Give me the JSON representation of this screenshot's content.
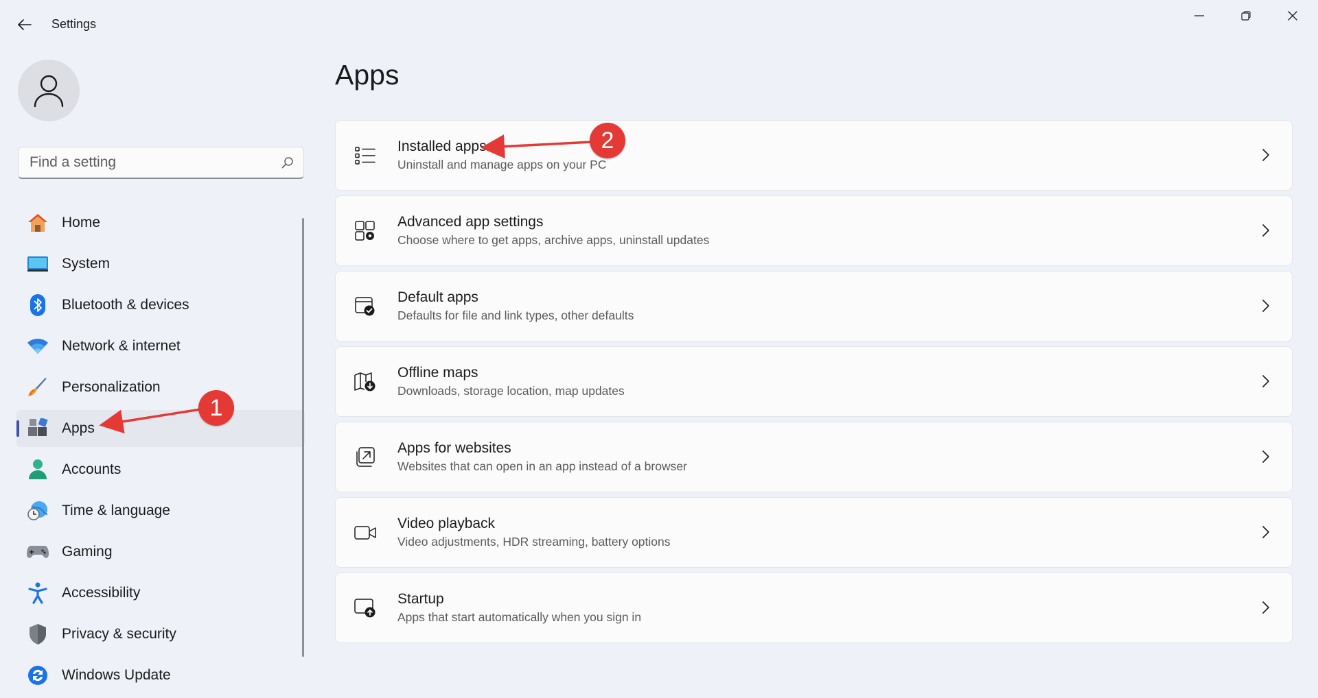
{
  "window": {
    "title": "Settings"
  },
  "search": {
    "placeholder": "Find a setting"
  },
  "sidebar": {
    "items": [
      {
        "label": "Home",
        "icon": "home-icon"
      },
      {
        "label": "System",
        "icon": "system-icon"
      },
      {
        "label": "Bluetooth & devices",
        "icon": "bluetooth-icon"
      },
      {
        "label": "Network & internet",
        "icon": "wifi-icon"
      },
      {
        "label": "Personalization",
        "icon": "brush-icon"
      },
      {
        "label": "Apps",
        "icon": "apps-icon",
        "selected": true
      },
      {
        "label": "Accounts",
        "icon": "person-icon"
      },
      {
        "label": "Time & language",
        "icon": "globe-clock-icon"
      },
      {
        "label": "Gaming",
        "icon": "gamepad-icon"
      },
      {
        "label": "Accessibility",
        "icon": "accessibility-icon"
      },
      {
        "label": "Privacy & security",
        "icon": "shield-icon"
      },
      {
        "label": "Windows Update",
        "icon": "update-icon"
      }
    ]
  },
  "main": {
    "title": "Apps",
    "cards": [
      {
        "title": "Installed apps",
        "desc": "Uninstall and manage apps on your PC",
        "icon": "list-icon"
      },
      {
        "title": "Advanced app settings",
        "desc": "Choose where to get apps, archive apps, uninstall updates",
        "icon": "app-gear-icon"
      },
      {
        "title": "Default apps",
        "desc": "Defaults for file and link types, other defaults",
        "icon": "default-check-icon"
      },
      {
        "title": "Offline maps",
        "desc": "Downloads, storage location, map updates",
        "icon": "map-download-icon"
      },
      {
        "title": "Apps for websites",
        "desc": "Websites that can open in an app instead of a browser",
        "icon": "open-external-icon"
      },
      {
        "title": "Video playback",
        "desc": "Video adjustments, HDR streaming, battery options",
        "icon": "video-camera-icon"
      },
      {
        "title": "Startup",
        "desc": "Apps that start automatically when you sign in",
        "icon": "startup-icon"
      }
    ]
  },
  "annotations": {
    "badge1": "1",
    "badge2": "2",
    "color": "#e53935"
  },
  "colors": {
    "accent": "#3f51b5",
    "background": "#eef1f7",
    "card": "#fbfbfc"
  }
}
